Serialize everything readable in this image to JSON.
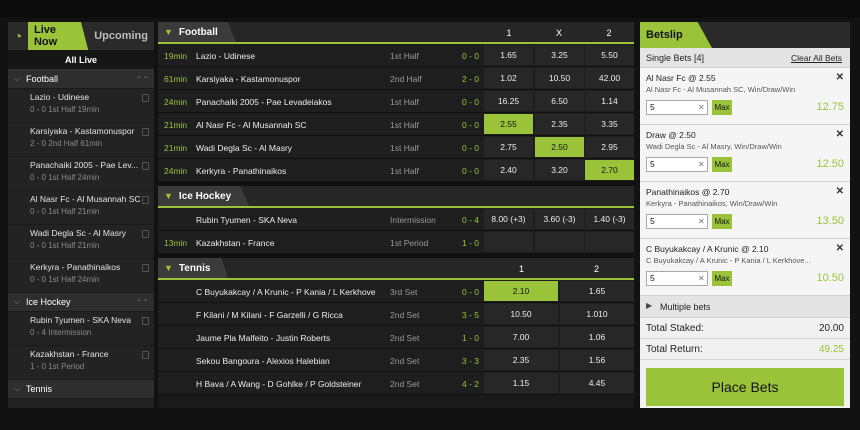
{
  "left": {
    "tabs": [
      {
        "label": "Live Now"
      },
      {
        "label": "Upcoming"
      }
    ],
    "all_live": "All Live",
    "football": {
      "title": "Football",
      "items": [
        {
          "name": "Lazio - Udinese",
          "status": "0 - 0  1st Half  19min"
        },
        {
          "name": "Karsiyaka - Kastamonuspor",
          "status": "2 - 0  2nd Half  61min"
        },
        {
          "name": "Panachaiki 2005 - Pae Lev...",
          "status": "0 - 0  1st Half  24min"
        },
        {
          "name": "Al Nasr Fc - Al Musannah SC",
          "status": "0 - 0  1st Half  21min"
        },
        {
          "name": "Wadi Degla Sc - Al Masry",
          "status": "0 - 0  1st Half  21min"
        },
        {
          "name": "Kerkyra - Panathinaikos",
          "status": "0 - 0  1st Half  24min"
        }
      ]
    },
    "icehockey": {
      "title": "Ice Hockey",
      "items": [
        {
          "name": "Rubin Tyumen - SKA Neva",
          "status": "0 - 4  Intermission"
        },
        {
          "name": "Kazakhstan - France",
          "status": "1 - 0  1st Period"
        }
      ]
    },
    "tennis": {
      "title": "Tennis"
    }
  },
  "football": {
    "title": "Football",
    "cols": [
      "1",
      "X",
      "2"
    ],
    "rows": [
      {
        "time": "19min",
        "match": "Lazio - Udinese",
        "period": "1st Half",
        "score": "0 - 0",
        "odds": [
          "1.65",
          "3.25",
          "5.50"
        ]
      },
      {
        "time": "61min",
        "match": "Karsiyaka - Kastamonuspor",
        "period": "2nd Half",
        "score": "2 - 0",
        "odds": [
          "1.02",
          "10.50",
          "42.00"
        ]
      },
      {
        "time": "24min",
        "match": "Panachaiki 2005 - Pae Levadeiakos",
        "period": "1st Half",
        "score": "0 - 0",
        "odds": [
          "16.25",
          "6.50",
          "1.14"
        ]
      },
      {
        "time": "21min",
        "match": "Al Nasr Fc - Al Musannah SC",
        "period": "1st Half",
        "score": "0 - 0",
        "odds": [
          "2.55",
          "2.35",
          "3.35"
        ]
      },
      {
        "time": "21min",
        "match": "Wadi Degla Sc - Al Masry",
        "period": "1st Half",
        "score": "0 - 0",
        "odds": [
          "2.75",
          "2.50",
          "2.95"
        ]
      },
      {
        "time": "24min",
        "match": "Kerkyra - Panathinaikos",
        "period": "1st Half",
        "score": "0 - 0",
        "odds": [
          "2.40",
          "3.20",
          "2.70"
        ]
      }
    ]
  },
  "icehockey": {
    "title": "Ice Hockey",
    "rows": [
      {
        "time": "",
        "match": "Rubin Tyumen - SKA Neva",
        "period": "Intermission",
        "score": "0 - 4",
        "odds": [
          "8.00 (+3)",
          "3.60 (-3)",
          "1.40 (-3)"
        ]
      },
      {
        "time": "13min",
        "match": "Kazakhstan - France",
        "period": "1st Period",
        "score": "1 - 0",
        "odds": [
          "",
          "",
          ""
        ]
      }
    ]
  },
  "tennis": {
    "title": "Tennis",
    "cols": [
      "1",
      "2"
    ],
    "rows": [
      {
        "match": "C Buyukakcay / A Krunic - P Kania / L Kerkhove",
        "period": "3rd Set",
        "score": "0 - 0",
        "odds": [
          "2.10",
          "1.65"
        ]
      },
      {
        "match": "F Kilani / M Kilani - F Garzelli / G Ricca",
        "period": "2nd Set",
        "score": "3 - 5",
        "odds": [
          "10.50",
          "1.010"
        ]
      },
      {
        "match": "Jaume Pla Malfeito - Justin Roberts",
        "period": "2nd Set",
        "score": "1 - 0",
        "odds": [
          "7.00",
          "1.06"
        ]
      },
      {
        "match": "Sekou Bangoura - Alexios Halebian",
        "period": "2nd Set",
        "score": "3 - 3",
        "odds": [
          "2.35",
          "1.56"
        ]
      },
      {
        "match": "H Bava / A Wang - D Gohlke / P Goldsteiner",
        "period": "2nd Set",
        "score": "4 - 2",
        "odds": [
          "1.15",
          "4.45"
        ]
      }
    ]
  },
  "betslip": {
    "title": "Betslip",
    "single_bets": "Single Bets [4]",
    "clear_all": "Clear All Bets",
    "bets": [
      {
        "title": "Al Nasr Fc @ 2.55",
        "desc": "Al Nasr Fc - Al Musannah SC, Win/Draw/Win",
        "stake": "5",
        "return": "12.75"
      },
      {
        "title": "Draw @ 2.50",
        "desc": "Wadi Degla Sc - Al Masry, Win/Draw/Win",
        "stake": "5",
        "return": "12.50"
      },
      {
        "title": "Panathinaikos @ 2.70",
        "desc": "Kerkyra - Panathinaikos, Win/Draw/Win",
        "stake": "5",
        "return": "13.50"
      },
      {
        "title": "C Buyukakcay / A Krunic @ 2.10",
        "desc": "C Buyukakcay / A Krunic - P Kania / L Kerkhove...",
        "stake": "5",
        "return": "10.50"
      }
    ],
    "max_label": "Max",
    "remove_glyph": "✕",
    "clear_glyph": "✕",
    "multiple_bets": "Multiple bets",
    "total_staked_label": "Total Staked:",
    "total_staked": "20.00",
    "total_return_label": "Total Return:",
    "total_return": "49.25",
    "place_bets": "Place Bets"
  }
}
